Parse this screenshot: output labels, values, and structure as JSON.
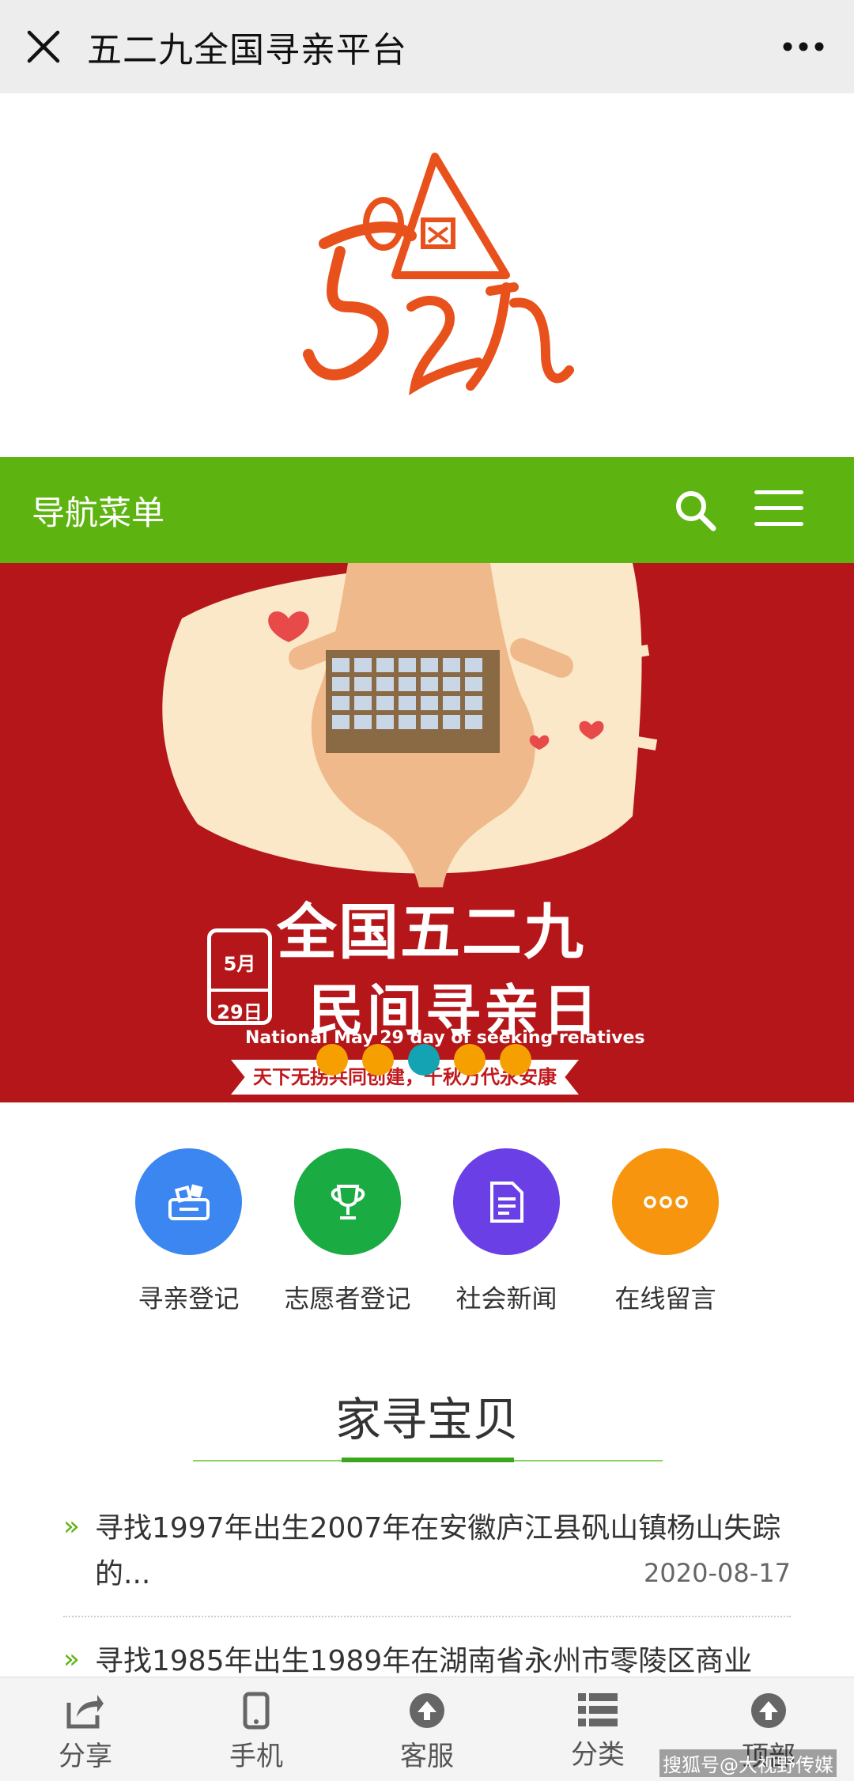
{
  "topbar": {
    "title": "五二九全国寻亲平台"
  },
  "navbar": {
    "label": "导航菜单"
  },
  "banner": {
    "title_line1": "全国五二九",
    "title_line2": "民间寻亲日",
    "month": "5月",
    "day": "29日",
    "subtitle_en": "National May 29 day of seeking relatives",
    "slogan": "天下无拐共同创建，千秋万代永安康",
    "slide_count": 5,
    "active_slide": 3
  },
  "shortcuts": [
    {
      "label": "寻亲登记",
      "color": "#3b86f0",
      "icon": "register-icon"
    },
    {
      "label": "志愿者登记",
      "color": "#1aab43",
      "icon": "trophy-icon"
    },
    {
      "label": "社会新闻",
      "color": "#6a3fe6",
      "icon": "document-icon"
    },
    {
      "label": "在线留言",
      "color": "#f7950f",
      "icon": "more-dots-icon"
    }
  ],
  "section": {
    "title": "家寻宝贝",
    "news": [
      {
        "text": "寻找1997年出生2007年在安徽庐江县矾山镇杨山失踪的...",
        "date": "2020-08-17"
      },
      {
        "text": "寻找1985年出生1989年在湖南省永州市零陵区商业",
        "date": ""
      }
    ]
  },
  "bottom_tabs": [
    {
      "label": "分享",
      "icon": "share-icon"
    },
    {
      "label": "手机",
      "icon": "phone-icon"
    },
    {
      "label": "客服",
      "icon": "upload-circle-icon"
    },
    {
      "label": "分类",
      "icon": "list-icon"
    },
    {
      "label": "顶部",
      "icon": "top-circle-icon"
    }
  ],
  "watermark": "搜狐号@大视野传媒",
  "colors": {
    "nav_green": "#5db30f",
    "banner_red": "#b5161a",
    "logo_orange": "#e8511c"
  }
}
